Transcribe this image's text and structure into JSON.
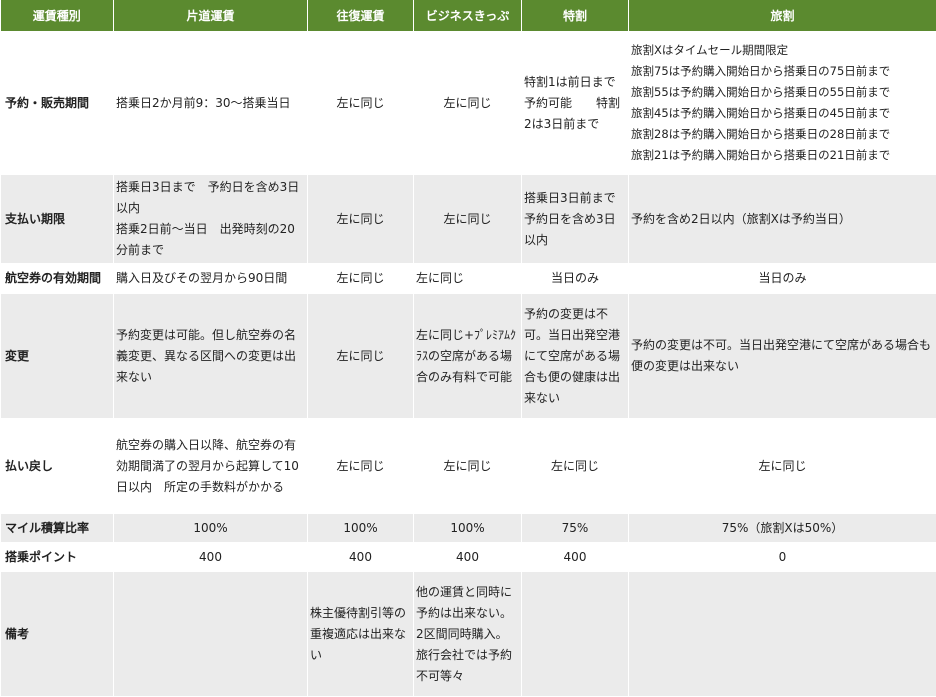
{
  "headers": [
    "運賃種別",
    "片道運賃",
    "往復運賃",
    "ビジネスきっぷ",
    "特割",
    "旅割"
  ],
  "rows": {
    "booking": {
      "label": "予約・販売期間",
      "oneway": "搭乗日2か月前9：30～搭乗当日",
      "roundtrip": "左に同じ",
      "business": "左に同じ",
      "tokuwari": "特割1は前日まで予約可能　　特割2は3日前まで",
      "tabiwari": "旅割Xはタイムセール期間限定\n旅割75は予約購入開始日から搭乗日の75日前まで\n旅割55は予約購入開始日から搭乗日の55日前まで\n旅割45は予約購入開始日から搭乗日の45日前まで\n旅割28は予約購入開始日から搭乗日の28日前まで\n旅割21は予約購入開始日から搭乗日の21日前まで"
    },
    "payment": {
      "label": "支払い期限",
      "oneway": "搭乗日3日まで　予約日を含め3日以内\n搭乗2日前～当日　出発時刻の20分前まで",
      "roundtrip": "左に同じ",
      "business": "左に同じ",
      "tokuwari": "搭乗日3日前まで予約日を含め3日以内",
      "tabiwari": "予約を含め2日以内（旅割Xは予約当日）"
    },
    "validity": {
      "label": "航空券の有効期間",
      "oneway": "購入日及びその翌月から90日間",
      "roundtrip": "左に同じ",
      "business": "左に同じ",
      "tokuwari": "当日のみ",
      "tabiwari": "当日のみ"
    },
    "change": {
      "label": "変更",
      "oneway": "予約変更は可能。但し航空券の名義変更、異なる区間への変更は出来ない",
      "roundtrip": "左に同じ",
      "business": "左に同じ+ﾌﾟﾚﾐｱﾑｸﾗｽの空席がある場合のみ有料で可能",
      "tokuwari": "予約の変更は不可。当日出発空港にて空席がある場合も便の健康は出来ない",
      "tabiwari": "予約の変更は不可。当日出発空港にて空席がある場合も便の変更は出来ない"
    },
    "refund": {
      "label": "払い戻し",
      "oneway": "航空券の購入日以降、航空券の有効期間満了の翌月から起算して10日以内　所定の手数料がかかる",
      "roundtrip": "左に同じ",
      "business": "左に同じ",
      "tokuwari": "左に同じ",
      "tabiwari": "左に同じ"
    },
    "mileage": {
      "label": "マイル積算比率",
      "oneway": "100%",
      "roundtrip": "100%",
      "business": "100%",
      "tokuwari": "75%",
      "tabiwari": "75%（旅割Xは50%）"
    },
    "points": {
      "label": "搭乗ポイント",
      "oneway": "400",
      "roundtrip": "400",
      "business": "400",
      "tokuwari": "400",
      "tabiwari": "0"
    },
    "notes": {
      "label": "備考",
      "oneway": "",
      "roundtrip": "株主優待割引等の重複適応は出来ない",
      "business": "他の運賃と同時に予約は出来ない。2区間同時購入。旅行会社では予約不可等々",
      "tokuwari": "",
      "tabiwari": ""
    }
  }
}
